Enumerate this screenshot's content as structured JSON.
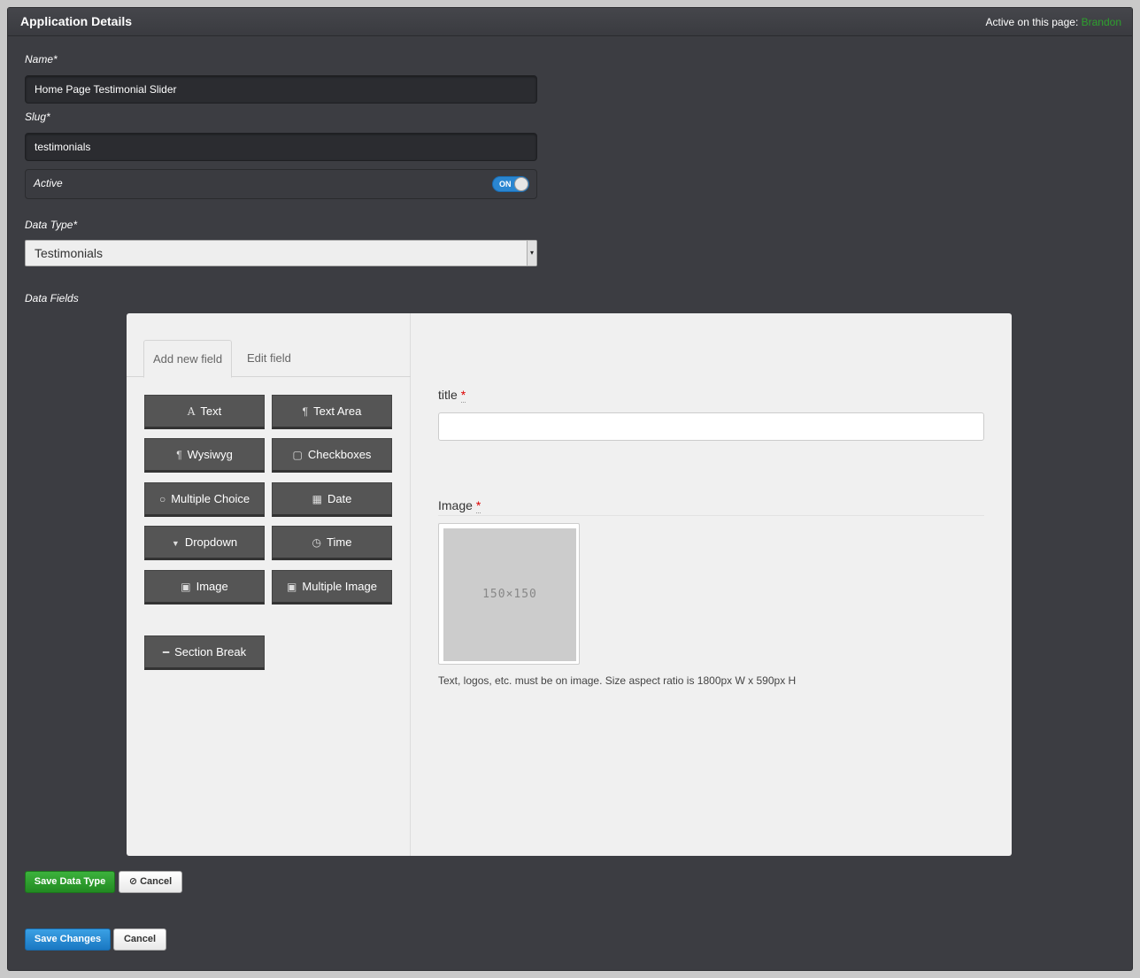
{
  "header": {
    "title": "Application Details",
    "active_label": "Active on this page:",
    "active_user": "Brandon"
  },
  "form": {
    "name_label": "Name*",
    "name_value": "Home Page Testimonial Slider",
    "slug_label": "Slug*",
    "slug_value": "testimonials",
    "active_label": "Active",
    "active_toggle": "ON",
    "data_type_label": "Data Type*",
    "data_type_value": "Testimonials",
    "data_fields_label": "Data Fields"
  },
  "field_builder": {
    "tabs": [
      "Add new field",
      "Edit field"
    ],
    "buttons": [
      {
        "label": "Text",
        "icon": "text-icon"
      },
      {
        "label": "Text Area",
        "icon": "pilcrow-icon"
      },
      {
        "label": "Wysiwyg",
        "icon": "pilcrow-icon"
      },
      {
        "label": "Checkboxes",
        "icon": "checkbox-icon"
      },
      {
        "label": "Multiple Choice",
        "icon": "radio-icon"
      },
      {
        "label": "Date",
        "icon": "calendar-icon"
      },
      {
        "label": "Dropdown",
        "icon": "caret-down-icon"
      },
      {
        "label": "Time",
        "icon": "clock-icon"
      },
      {
        "label": "Image",
        "icon": "image-icon"
      },
      {
        "label": "Multiple Image",
        "icon": "image-icon"
      },
      {
        "label": "Section Break",
        "icon": "minus-icon"
      }
    ]
  },
  "preview": {
    "title_label": "title",
    "image_label": "Image",
    "required_mark": "*",
    "placeholder_text": "150×150",
    "help_text": "Text, logos, etc. must be on image. Size aspect ratio is 1800px W x 590px H"
  },
  "actions": {
    "save_data_type": "Save Data Type",
    "cancel_data_type": "Cancel",
    "save_changes": "Save Changes",
    "cancel": "Cancel"
  },
  "colors": {
    "panel_bg": "#3c3d42",
    "accent_green": "#2ea02e",
    "accent_blue": "#2a86d1"
  }
}
